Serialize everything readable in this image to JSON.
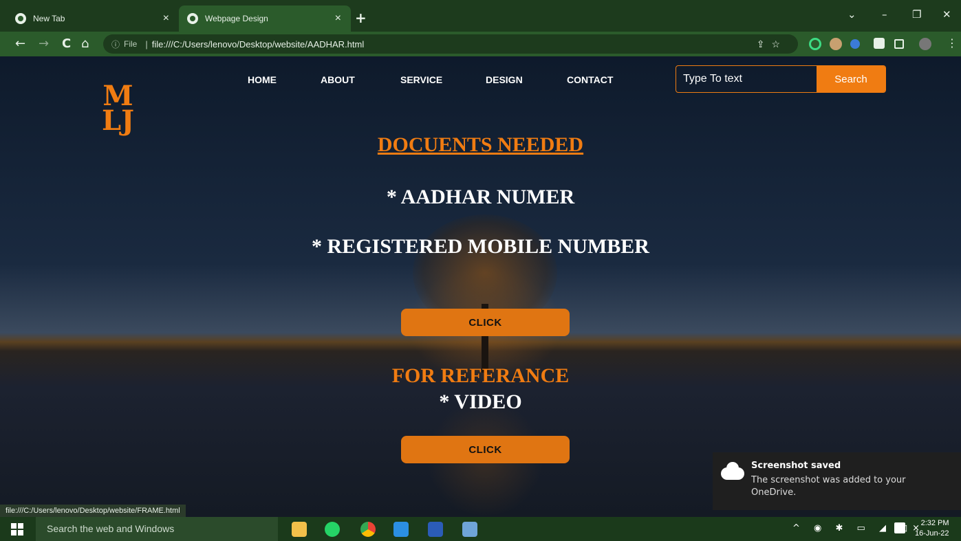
{
  "browser": {
    "tabs": [
      {
        "label": "New Tab",
        "icon": "chrome-icon",
        "close": "×"
      },
      {
        "label": "Webpage Design",
        "icon": "chrome-icon",
        "close": "×"
      }
    ],
    "new_tab": "+",
    "window_controls": {
      "dropdown": "⌄",
      "minimize": "–",
      "maximize": "❐",
      "close": "✕"
    },
    "nav": {
      "back": "←",
      "forward": "→",
      "reload": "C",
      "home": "⌂"
    },
    "address": {
      "info": "ⓘ",
      "scheme_label": "File",
      "separator": "|",
      "url": "file:///C:/Users/lenovo/Desktop/website/AADHAR.html"
    },
    "omni_icons": "⇪☆"
  },
  "page": {
    "logo": {
      "line1": "M",
      "line2": "LJ"
    },
    "nav": [
      "HOME",
      "ABOUT",
      "SERVICE",
      "DESIGN",
      "CONTACT"
    ],
    "search": {
      "placeholder": "Type To text",
      "button": "Search"
    },
    "heading": "DOCUENTS NEEDED",
    "item1": "* AADHAR NUMER",
    "item2": "* REGISTERED MOBILE NUMBER",
    "click1": "CLICK",
    "reference_heading": "FOR REFERANCE",
    "item3": "* VIDEO",
    "click2": "CLICK"
  },
  "status_url": "file:///C:/Users/lenovo/Desktop/website/FRAME.html",
  "toast": {
    "title": "Screenshot saved",
    "body": "The screenshot was added to your OneDrive."
  },
  "taskbar": {
    "search_placeholder": "Search the web and Windows",
    "tray": "^ ◉ ✱ ▭ ◢ ◁×",
    "time": "2:32 PM",
    "date": "16-Jun-22"
  },
  "colors": {
    "accent": "#f07c12",
    "button": "#e07512"
  }
}
